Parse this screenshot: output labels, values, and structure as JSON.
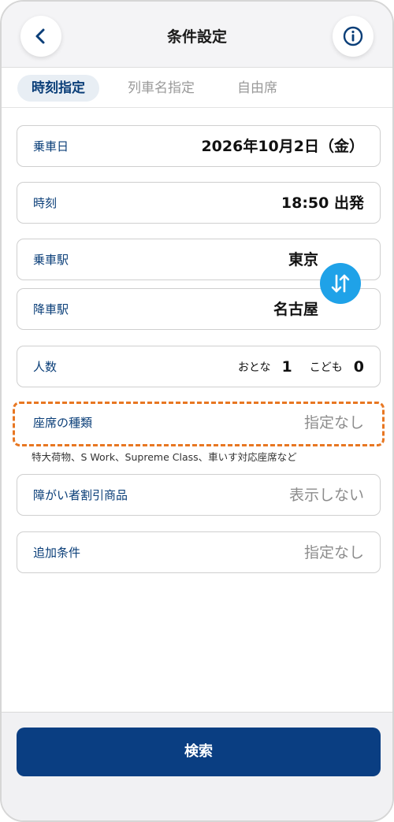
{
  "header": {
    "title": "条件設定",
    "back_icon": "chevron-left-icon",
    "info_icon": "info-icon"
  },
  "tabs": [
    {
      "label": "時刻指定",
      "active": true
    },
    {
      "label": "列車名指定",
      "active": false
    },
    {
      "label": "自由席",
      "active": false
    }
  ],
  "form": {
    "date": {
      "label": "乗車日",
      "value": "2026年10月2日（金）"
    },
    "time": {
      "label": "時刻",
      "value": "18:50 出発"
    },
    "from": {
      "label": "乗車駅",
      "value": "東京"
    },
    "to": {
      "label": "降車駅",
      "value": "名古屋"
    },
    "swap_icon": "swap-vertical-icon",
    "people": {
      "label": "人数",
      "adult_label": "おとな",
      "adult_count": "1",
      "child_label": "こども",
      "child_count": "0"
    },
    "seat_type": {
      "label": "座席の種類",
      "value": "指定なし",
      "note": "特大荷物、S Work、Supreme Class、車いす対応座席など"
    },
    "disability": {
      "label": "障がい者割引商品",
      "value": "表示しない"
    },
    "extra": {
      "label": "追加条件",
      "value": "指定なし"
    }
  },
  "footer": {
    "search_label": "検索"
  },
  "colors": {
    "brand": "#0a3e82",
    "accent": "#1fa2e8",
    "highlight": "#e87722"
  }
}
